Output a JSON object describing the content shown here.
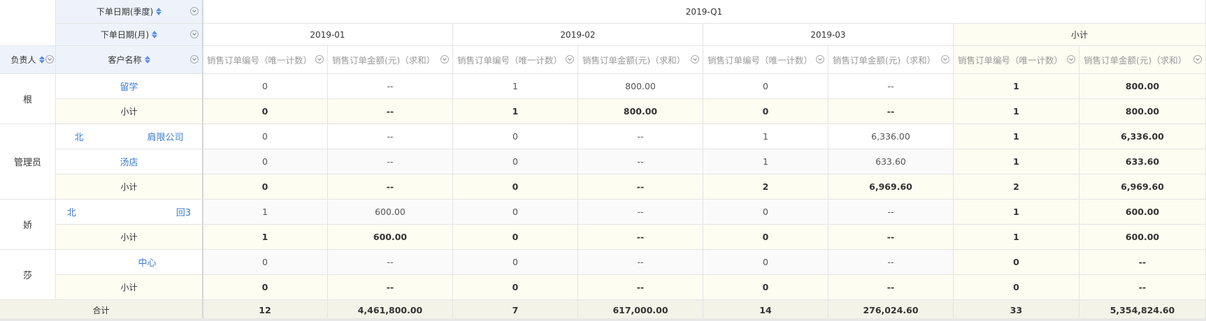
{
  "header": {
    "quarter_field": "下单日期(季度)",
    "month_field": "下单日期(月)",
    "owner_field": "负责人",
    "customer_field": "客户名称",
    "quarter_value": "2019-Q1",
    "months": [
      "2019-01",
      "2019-02",
      "2019-03"
    ],
    "subtotal": "小计",
    "measure_count": "销售订单编号（唯一计数）",
    "measure_sum": "销售订单金额(元)（求和）"
  },
  "rows": [
    {
      "owner": "根",
      "customer": "留学",
      "kind": "data",
      "vals": [
        "0",
        "--",
        "1",
        "800.00",
        "0",
        "--",
        "1",
        "800.00"
      ]
    },
    {
      "owner": "",
      "customer": "小计",
      "kind": "subtotal",
      "vals": [
        "0",
        "--",
        "1",
        "800.00",
        "0",
        "--",
        "1",
        "800.00"
      ]
    },
    {
      "owner": "",
      "customer": "北　　　　　　　肩限公司",
      "kind": "data",
      "vals": [
        "0",
        "--",
        "0",
        "--",
        "1",
        "6,336.00",
        "1",
        "6,336.00"
      ]
    },
    {
      "owner": "管理员",
      "customer": "汤店",
      "kind": "data",
      "vals": [
        "0",
        "--",
        "0",
        "--",
        "1",
        "633.60",
        "1",
        "633.60"
      ]
    },
    {
      "owner": "",
      "customer": "小计",
      "kind": "subtotal",
      "vals": [
        "0",
        "--",
        "0",
        "--",
        "2",
        "6,969.60",
        "2",
        "6,969.60"
      ]
    },
    {
      "owner": "娇",
      "customer": "北　　　　　　　　　　　回3",
      "kind": "data",
      "vals": [
        "1",
        "600.00",
        "0",
        "--",
        "0",
        "--",
        "1",
        "600.00"
      ]
    },
    {
      "owner": "",
      "customer": "小计",
      "kind": "subtotal",
      "vals": [
        "1",
        "600.00",
        "0",
        "--",
        "0",
        "--",
        "1",
        "600.00"
      ]
    },
    {
      "owner": "莎",
      "customer": "　　　　中心",
      "kind": "data",
      "vals": [
        "0",
        "--",
        "0",
        "--",
        "0",
        "--",
        "0",
        "--"
      ]
    },
    {
      "owner": "",
      "customer": "小计",
      "kind": "subtotal",
      "vals": [
        "0",
        "--",
        "0",
        "--",
        "0",
        "--",
        "0",
        "--"
      ]
    }
  ],
  "total": {
    "label": "合计",
    "vals": [
      "12",
      "4,461,800.00",
      "7",
      "617,000.00",
      "14",
      "276,024.60",
      "33",
      "5,354,824.60"
    ]
  }
}
